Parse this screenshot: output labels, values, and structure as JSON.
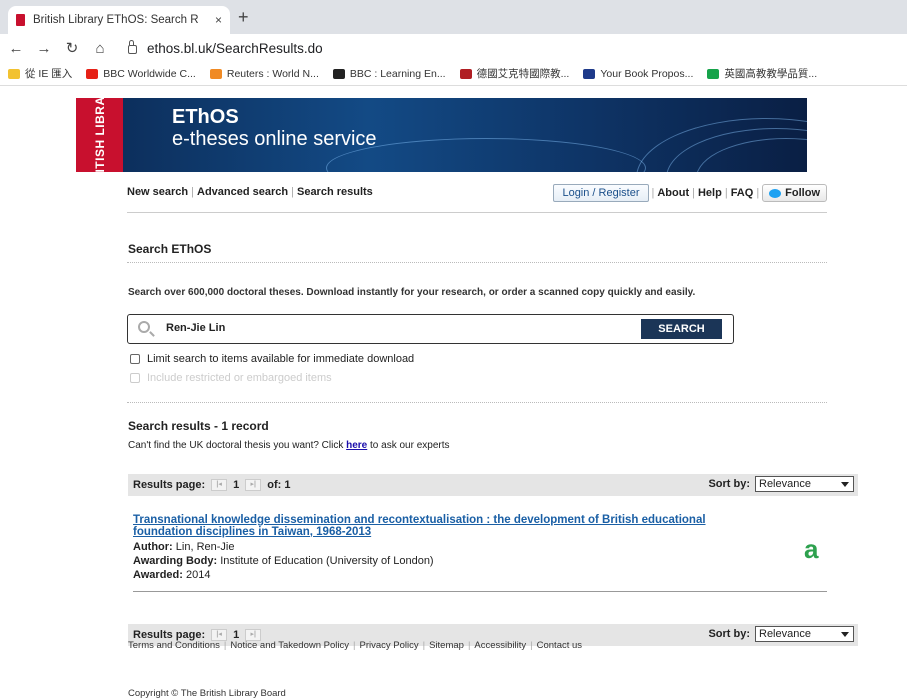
{
  "browser": {
    "tab_title": "British Library EThOS: Search R",
    "tab_close": "×",
    "new_tab": "+",
    "url": "ethos.bl.uk/SearchResults.do",
    "bookmarks": [
      {
        "label": "從 IE 匯入",
        "color": "#f2c230"
      },
      {
        "label": "BBC Worldwide C...",
        "color": "#e62117"
      },
      {
        "label": "Reuters : World N...",
        "color": "#f08a24"
      },
      {
        "label": "BBC : Learning En...",
        "color": "#222222"
      },
      {
        "label": "德國艾克特國際教...",
        "color": "#b01e23"
      },
      {
        "label": "Your Book Propos...",
        "color": "#1e3a8a"
      },
      {
        "label": "英國高教教學品質...",
        "color": "#16a34a"
      }
    ]
  },
  "banner": {
    "logo_text": "BRITISH LIBRARY",
    "title": "EThOS",
    "subtitle": "e-theses online service"
  },
  "topnav": {
    "new_search": "New search",
    "advanced_search": "Advanced search",
    "search_results": "Search results",
    "login": "Login / Register",
    "about": "About",
    "help": "Help",
    "faq": "FAQ",
    "follow": "Follow"
  },
  "search": {
    "heading": "Search EThOS",
    "tagline": "Search over 600,000 doctoral theses. Download instantly for your research, or order a scanned copy quickly and easily.",
    "query": "Ren-Jie Lin",
    "button": "SEARCH",
    "limit_label": "Limit search to items available for immediate download",
    "restricted_label": "Include restricted or embargoed items"
  },
  "results": {
    "heading": "Search results - 1 record",
    "cantfind_prefix": "Can't find the UK doctoral thesis you want? Click ",
    "cantfind_link": "here",
    "cantfind_suffix": " to ask our experts",
    "pager_label": "Results page:",
    "current_page": "1",
    "of_label": "of: 1",
    "sort_label": "Sort by:",
    "sort_value": "Relevance",
    "record": {
      "title_line1": "Transnational knowledge dissemination and recontextualisation : the development of British educational",
      "title_line2": "foundation disciplines in Taiwan, 1968-2013",
      "author_label": "Author:",
      "author": "Lin, Ren-Jie",
      "body_label": "Awarding Body:",
      "body": "Institute of Education (University of London)",
      "awarded_label": "Awarded:",
      "awarded": "2014",
      "oa_symbol": "a"
    }
  },
  "footer": {
    "links": [
      "Terms and Conditions",
      "Notice and Takedown Policy",
      "Privacy Policy",
      "Sitemap",
      "Accessibility",
      "Contact us"
    ],
    "copyright": "Copyright © The British Library Board"
  }
}
